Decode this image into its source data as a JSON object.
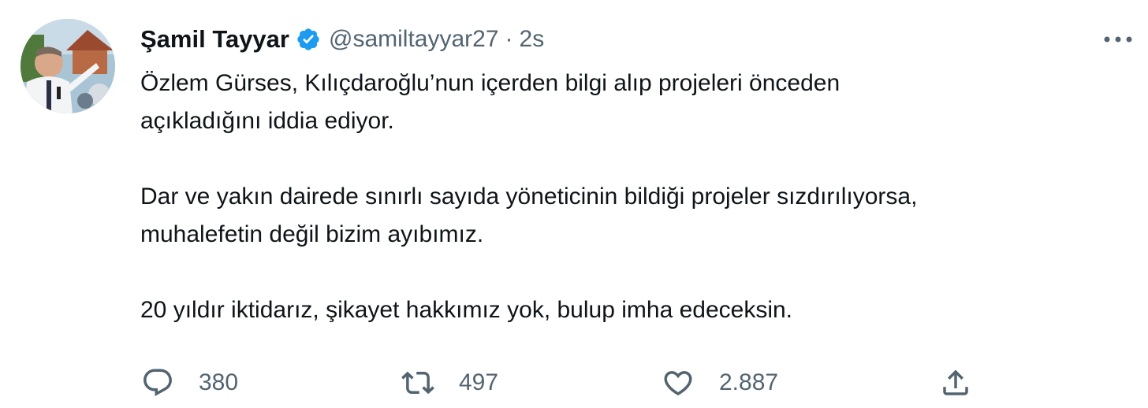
{
  "tweet": {
    "display_name": "Şamil Tayyar",
    "handle": "@samiltayyar27",
    "separator": "·",
    "time": "2s",
    "paragraphs": [
      "Özlem Gürses, Kılıçdaroğlu’nun içerden bilgi alıp projeleri önceden\naçıkladığını iddia ediyor.",
      "Dar ve yakın dairede sınırlı sayıda yöneticinin bildiği projeler sızdırılıyorsa,\nmuhalefetin değil bizim ayıbımız.",
      "20 yıldır iktidarız, şikayet hakkımız yok, bulup imha edeceksin."
    ]
  },
  "actions": {
    "reply_count": "380",
    "retweet_count": "497",
    "like_count": "2.887"
  },
  "colors": {
    "text": "#0f1419",
    "muted": "#536471",
    "verified": "#1d9bf0"
  },
  "icons": {
    "verified": "verified-badge-icon",
    "more": "more-dots-icon",
    "reply": "reply-bubble-icon",
    "retweet": "retweet-arrows-icon",
    "like": "heart-icon",
    "share": "share-upload-icon"
  }
}
